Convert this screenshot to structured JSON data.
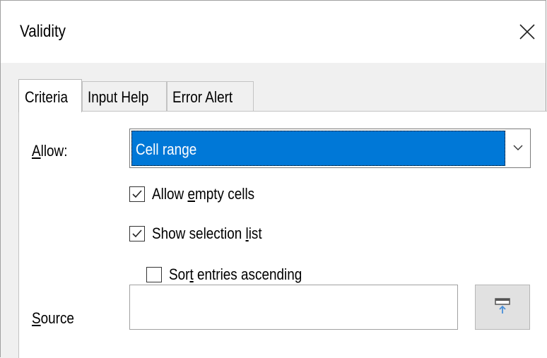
{
  "dialog": {
    "title": "Validity",
    "close_icon": "close-icon"
  },
  "tabs": [
    {
      "label": "Criteria",
      "active": true
    },
    {
      "label": "Input Help",
      "active": false
    },
    {
      "label": "Error Alert",
      "active": false
    }
  ],
  "criteria": {
    "allow_label": "Allow:",
    "allow_value": "Cell range",
    "allow_empty_cells": {
      "label": "Allow empty cells",
      "checked": true
    },
    "show_selection_list": {
      "label": "Show selection list",
      "checked": true
    },
    "sort_entries_ascending": {
      "label": "Sort entries ascending",
      "checked": false
    },
    "source_label": "Source",
    "source_value": "",
    "shrink_icon": "shrink-dialog-icon"
  },
  "colors": {
    "accent": "#0078d7",
    "content_bg": "#f0f0f0"
  }
}
